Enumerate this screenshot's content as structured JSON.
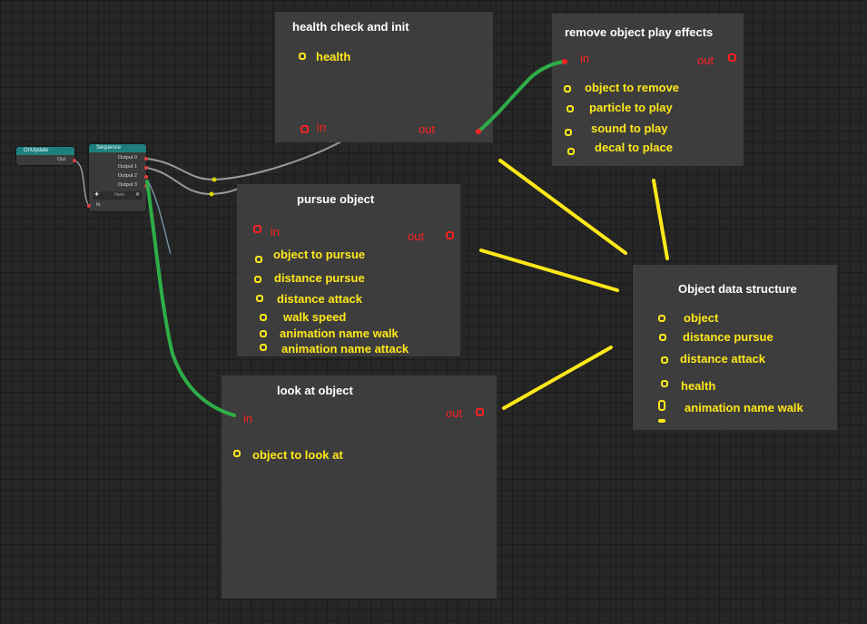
{
  "colors": {
    "annotation_yellow": "#ffe81a",
    "annotation_red": "#ff2020",
    "annotation_green": "#2fae48",
    "panel": "#3d3d3d",
    "node_header": "#1f7f7f"
  },
  "onupdate_node": {
    "title": "OnUpdate",
    "out": "Out"
  },
  "sequence_node": {
    "title": "Sequence",
    "outputs": [
      "Output 0",
      "Output 1",
      "Output 2",
      "Output 3"
    ],
    "new_label": "New",
    "close": "✕",
    "plus": "✚",
    "input": "In"
  },
  "panels": {
    "health": {
      "title": "health check and init",
      "field": "health",
      "in": "in",
      "out": "out"
    },
    "remove": {
      "title": "remove object play effects",
      "in": "in",
      "out": "out",
      "fields": [
        "object to remove",
        "particle to play",
        "sound to play",
        "decal to place"
      ]
    },
    "pursue": {
      "title": "pursue object",
      "in": "in",
      "out": "out",
      "fields": [
        "object to pursue",
        "distance pursue",
        "distance attack",
        "walk speed",
        "animation name walk",
        "animation name attack"
      ]
    },
    "look": {
      "title": "look at object",
      "in": "in",
      "out": "out",
      "field": "object to look at"
    },
    "data": {
      "title": "Object data structure",
      "fields": [
        "object",
        "distance pursue",
        "distance attack",
        "health",
        "animation name walk"
      ]
    }
  }
}
